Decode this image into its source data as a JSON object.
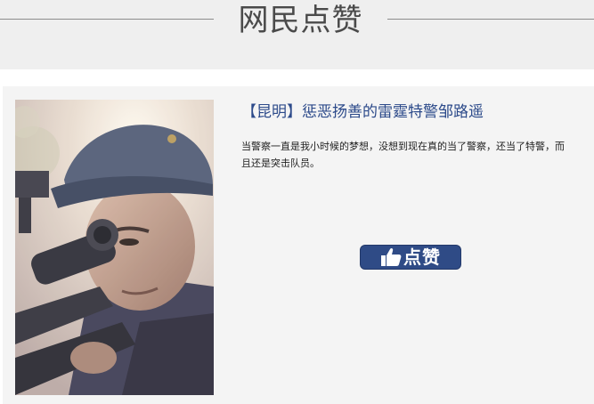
{
  "section": {
    "title": "网民点赞"
  },
  "article": {
    "headline_prefix": "【昆明】",
    "headline": "惩恶扬善的雷霆特警邹路遥",
    "description": "当警察一直是我小时候的梦想，没想到现在真的当了警察，还当了特警，而且还是突击队员。",
    "photo_subject": "sniper officer in cap aiming rifle"
  },
  "like_button": {
    "icon": "thumbs-up-icon",
    "label": "点赞",
    "color": "#2f4b86"
  }
}
